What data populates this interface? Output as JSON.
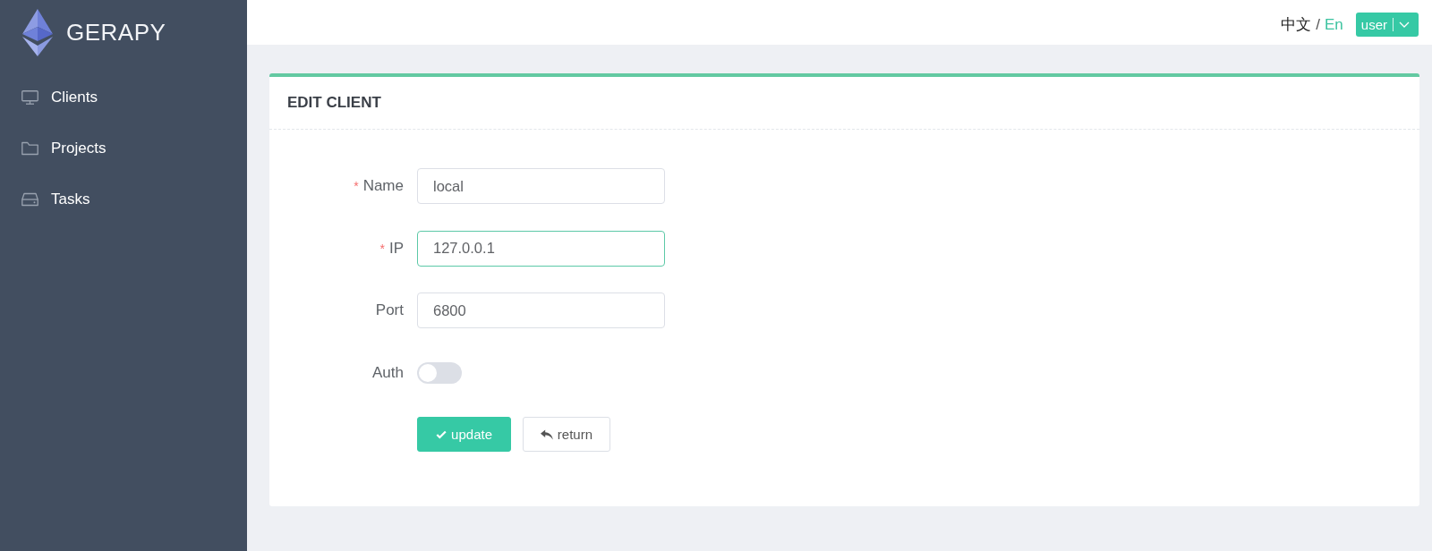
{
  "sidebar": {
    "title": "GERAPY",
    "items": [
      {
        "label": "Clients",
        "selected": false
      },
      {
        "label": "Projects",
        "selected": false
      },
      {
        "label": "Tasks",
        "selected": false
      }
    ]
  },
  "header": {
    "languages": [
      {
        "label": "中文",
        "selected": false
      },
      {
        "label": "En",
        "selected": true
      }
    ],
    "separator": "/",
    "user_menu": {
      "label": "user"
    }
  },
  "card": {
    "title": "EDIT CLIENT",
    "fields": [
      {
        "kind": "text",
        "label": "Name",
        "required_mark": "*",
        "value": "local",
        "focused": false
      },
      {
        "kind": "text",
        "label": "IP",
        "required_mark": "*",
        "value": "127.0.0.1",
        "focused": true
      },
      {
        "kind": "text",
        "label": "Port",
        "value": "6800",
        "focused": false
      },
      {
        "kind": "switch",
        "label": "Auth",
        "on": false
      }
    ],
    "buttons": [
      {
        "kind": "primary",
        "label": "update"
      },
      {
        "kind": "default",
        "label": "return"
      }
    ]
  }
}
